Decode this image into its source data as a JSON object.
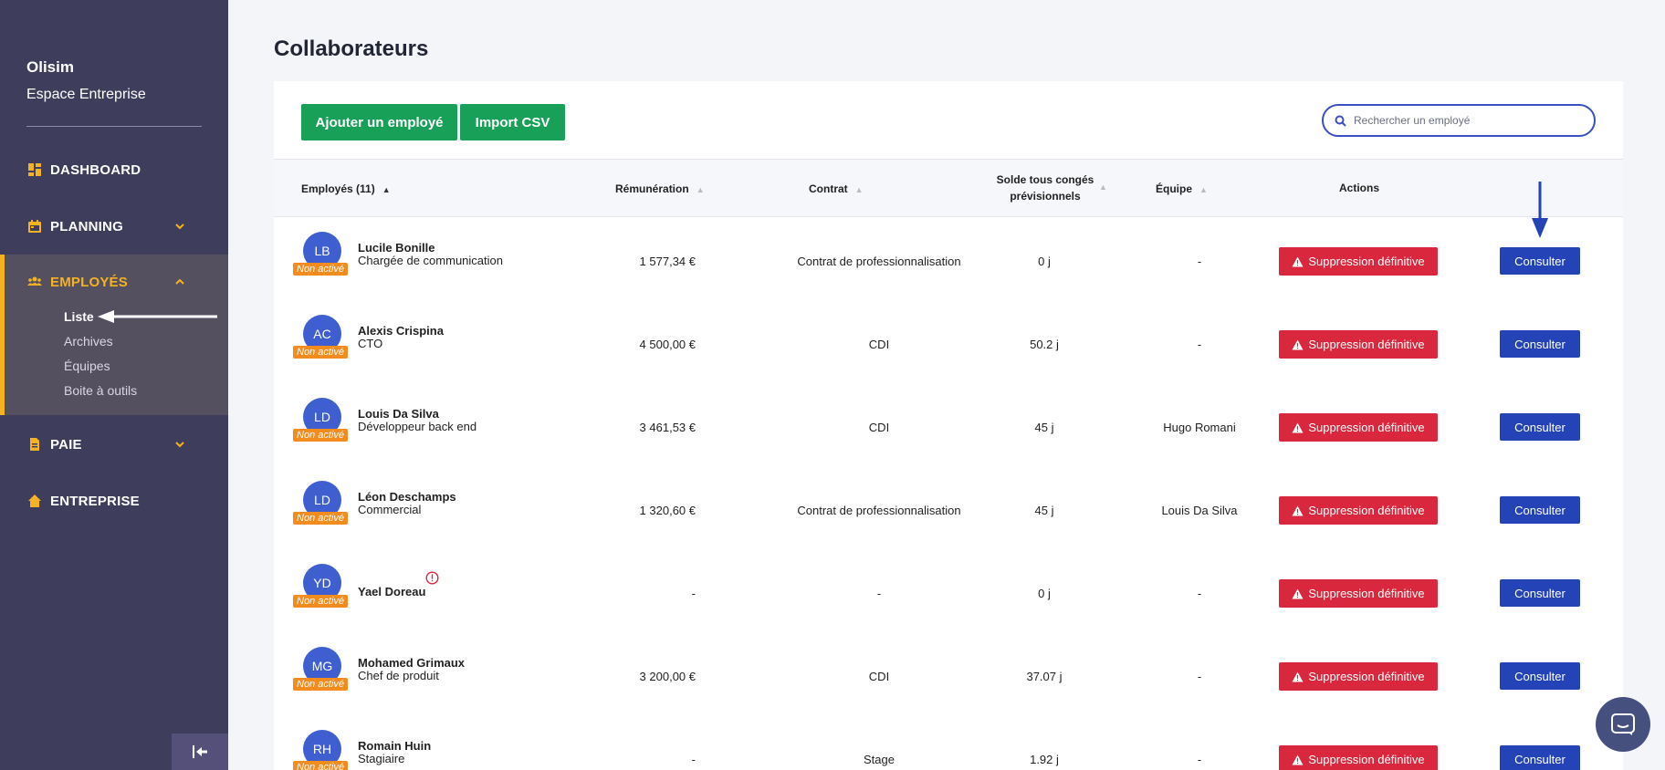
{
  "sidebar": {
    "company": "Olisim",
    "space": "Espace Entreprise",
    "nav": {
      "dashboard": "DASHBOARD",
      "planning": "PLANNING",
      "employes": "EMPLOYÉS",
      "paie": "PAIE",
      "entreprise": "ENTREPRISE"
    },
    "sub": {
      "liste": "Liste",
      "archives": "Archives",
      "equipes": "Équipes",
      "boite": "Boite à outils"
    }
  },
  "page": {
    "title": "Collaborateurs"
  },
  "toolbar": {
    "add_label": "Ajouter un employé",
    "import_label": "Import CSV",
    "search_placeholder": "Rechercher un employé"
  },
  "table": {
    "headers": {
      "employes": "Employés (11)",
      "remuneration": "Rémunération",
      "contrat": "Contrat",
      "solde_l1": "Solde tous congés",
      "solde_l2": "prévisionnels",
      "equipe": "Équipe",
      "actions": "Actions"
    },
    "badge_label": "Non activé",
    "delete_label": "Suppression définitive",
    "consult_label": "Consulter",
    "rows": [
      {
        "initials": "LB",
        "name": "Lucile Bonille",
        "role": "Chargée de communication",
        "pay": "1 577,34 €",
        "contract": "Contrat de professionnalisation",
        "leave": "0 j",
        "team": "-"
      },
      {
        "initials": "AC",
        "name": "Alexis Crispina",
        "role": "CTO",
        "pay": "4 500,00 €",
        "contract": "CDI",
        "leave": "50.2 j",
        "team": "-"
      },
      {
        "initials": "LD",
        "name": "Louis Da Silva",
        "role": "Développeur back end",
        "pay": "3 461,53 €",
        "contract": "CDI",
        "leave": "45 j",
        "team": "Hugo Romani"
      },
      {
        "initials": "LD",
        "name": "Léon Deschamps",
        "role": "Commercial",
        "pay": "1 320,60 €",
        "contract": "Contrat de professionnalisation",
        "leave": "45 j",
        "team": "Louis Da Silva"
      },
      {
        "initials": "YD",
        "name": "Yael Doreau",
        "role": "",
        "pay": "-",
        "contract": "-",
        "leave": "0 j",
        "team": "-"
      },
      {
        "initials": "MG",
        "name": "Mohamed Grimaux",
        "role": "Chef de produit",
        "pay": "3 200,00 €",
        "contract": "CDI",
        "leave": "37.07 j",
        "team": "-"
      },
      {
        "initials": "RH",
        "name": "Romain Huin",
        "role": "Stagiaire",
        "pay": "-",
        "contract": "Stage",
        "leave": "1.92 j",
        "team": "-"
      }
    ]
  },
  "colors": {
    "sidebar": "#3f3d5c",
    "accent": "#f5b323",
    "green": "#18a058",
    "danger": "#d9283d",
    "primary": "#2343b6",
    "badge": "#f28c1e"
  }
}
